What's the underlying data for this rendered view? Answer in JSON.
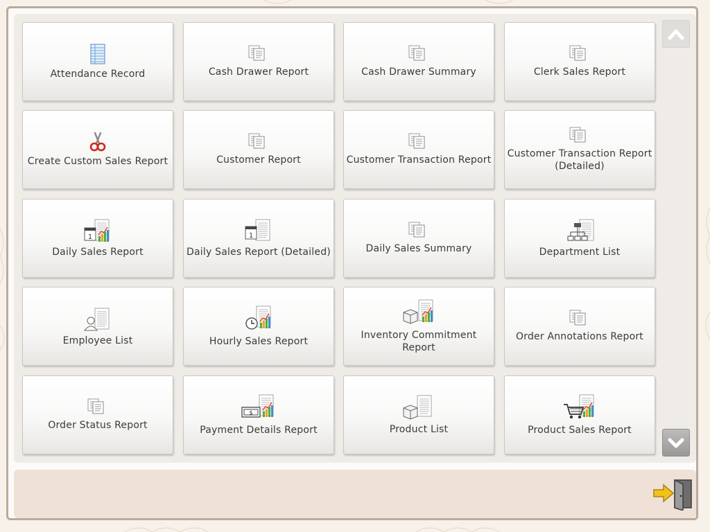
{
  "reports": [
    {
      "label": "Attendance Record",
      "icon": "attendance-sheet-icon"
    },
    {
      "label": "Cash Drawer Report",
      "icon": "report-pages-icon"
    },
    {
      "label": "Cash Drawer Summary",
      "icon": "report-pages-icon"
    },
    {
      "label": "Clerk Sales Report",
      "icon": "report-pages-icon"
    },
    {
      "label": "Create Custom Sales Report",
      "icon": "scissors-icon"
    },
    {
      "label": "Customer Report",
      "icon": "report-pages-icon"
    },
    {
      "label": "Customer Transaction Report",
      "icon": "report-pages-icon"
    },
    {
      "label": "Customer Transaction Report (Detailed)",
      "icon": "report-pages-icon"
    },
    {
      "label": "Daily Sales Report",
      "icon": "calendar-chart-icon"
    },
    {
      "label": "Daily Sales Report (Detailed)",
      "icon": "calendar-report-icon"
    },
    {
      "label": "Daily Sales Summary",
      "icon": "report-pages-icon"
    },
    {
      "label": "Department List",
      "icon": "org-chart-report-icon"
    },
    {
      "label": "Employee List",
      "icon": "person-report-icon"
    },
    {
      "label": "Hourly Sales Report",
      "icon": "clock-chart-icon"
    },
    {
      "label": "Inventory Commitment Report",
      "icon": "boxes-chart-icon"
    },
    {
      "label": "Order Annotations Report",
      "icon": "report-pages-icon"
    },
    {
      "label": "Order Status Report",
      "icon": "report-pages-icon"
    },
    {
      "label": "Payment Details Report",
      "icon": "cash-chart-icon"
    },
    {
      "label": "Product List",
      "icon": "boxes-report-icon"
    },
    {
      "label": "Product Sales Report",
      "icon": "cart-chart-icon"
    }
  ],
  "scroll": {
    "up_icon": "chevron-up-icon",
    "down_icon": "chevron-down-icon"
  },
  "exit": {
    "icon": "exit-door-icon"
  },
  "colors": {
    "panel": "#efece7",
    "status_bar": "#efe1d6",
    "border": "#b8ab9d",
    "text": "#3a3a3a",
    "chart_red": "#e53a2b",
    "chart_green": "#4caf3c",
    "chart_orange": "#f0a21e",
    "arrow_yellow": "#f2c21a"
  }
}
